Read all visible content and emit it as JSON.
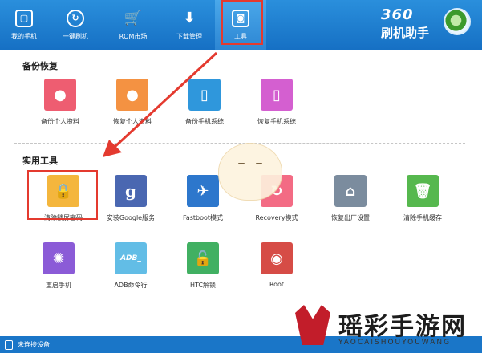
{
  "topnav": {
    "items": [
      {
        "label": "我的手机",
        "icon": "phone-icon"
      },
      {
        "label": "一键刷机",
        "icon": "flash-icon"
      },
      {
        "label": "ROM市场",
        "icon": "cart-icon"
      },
      {
        "label": "下载管理",
        "icon": "download-icon"
      },
      {
        "label": "工具",
        "icon": "toolbox-icon"
      }
    ],
    "active_index": 4
  },
  "brand": {
    "number": "360",
    "name": "刷机助手"
  },
  "sections": {
    "backup": {
      "title": "备份恢复",
      "items": [
        {
          "label": "备份个人资料",
          "icon": "person-icon",
          "color": "#ee5d71"
        },
        {
          "label": "恢复个人资料",
          "icon": "person-restore-icon",
          "color": "#f49242"
        },
        {
          "label": "备份手机系统",
          "icon": "phone-backup-icon",
          "color": "#2f97dc"
        },
        {
          "label": "恢复手机系统",
          "icon": "phone-restore-icon",
          "color": "#d45fd0"
        }
      ]
    },
    "tools": {
      "title": "实用工具",
      "items": [
        {
          "label": "清除锁屏密码",
          "icon": "lock-icon",
          "color": "#f4b63d"
        },
        {
          "label": "安装Google服务",
          "icon": "google-icon",
          "color": "#4a67b1",
          "glyph": "g"
        },
        {
          "label": "Fastboot模式",
          "icon": "rocket-icon",
          "color": "#2d77cc"
        },
        {
          "label": "Recovery模式",
          "icon": "refresh-icon",
          "color": "#f36b84"
        },
        {
          "label": "恢复出厂设置",
          "icon": "home-icon",
          "color": "#7b8c9e"
        },
        {
          "label": "清除手机缓存",
          "icon": "trash-icon",
          "color": "#56b84e"
        },
        {
          "label": "重启手机",
          "icon": "spinner-icon",
          "color": "#8b5bd7"
        },
        {
          "label": "ADB命令行",
          "icon": "terminal-icon",
          "color": "#62bde6",
          "glyph": "ADB_"
        },
        {
          "label": "HTC解锁",
          "icon": "unlock-icon",
          "color": "#41b062"
        },
        {
          "label": "Root",
          "icon": "keyhole-icon",
          "color": "#d64c46"
        }
      ]
    }
  },
  "status": {
    "text": "未连接设备"
  },
  "watermark": {
    "text": "瑶彩手游网",
    "sub": "YAOCAISHOUYOUWANG"
  }
}
